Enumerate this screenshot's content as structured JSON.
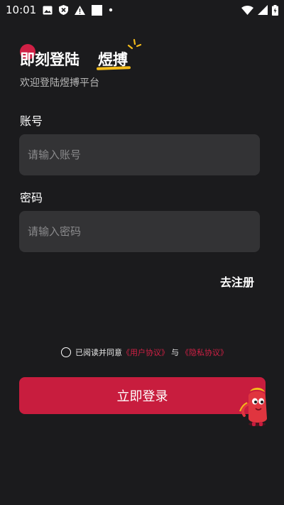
{
  "status_bar": {
    "time": "10:01",
    "left_icons": [
      "image-icon",
      "blocked-icon",
      "warning-icon",
      "square-icon",
      "dot-icon"
    ],
    "right_icons": [
      "wifi-icon",
      "signal-icon",
      "battery-charging-icon"
    ]
  },
  "header": {
    "title": "即刻登陆",
    "brand": "煜搏",
    "subtitle": "欢迎登陆煜搏平台"
  },
  "form": {
    "account_label": "账号",
    "account_placeholder": "请输入账号",
    "account_value": "",
    "password_label": "密码",
    "password_placeholder": "请输入密码",
    "password_value": ""
  },
  "register_link": "去注册",
  "agreement": {
    "checked": false,
    "prefix": "已阅读并同意",
    "user_agreement": "《用户协议》",
    "conjunction": "与",
    "privacy_policy": "《隐私协议》"
  },
  "login_button": "立即登录",
  "colors": {
    "background": "#1b1b1d",
    "accent": "#c81d3e",
    "link": "#d02045",
    "input_bg": "#333335",
    "brand_underline": "#f3bb1b"
  }
}
